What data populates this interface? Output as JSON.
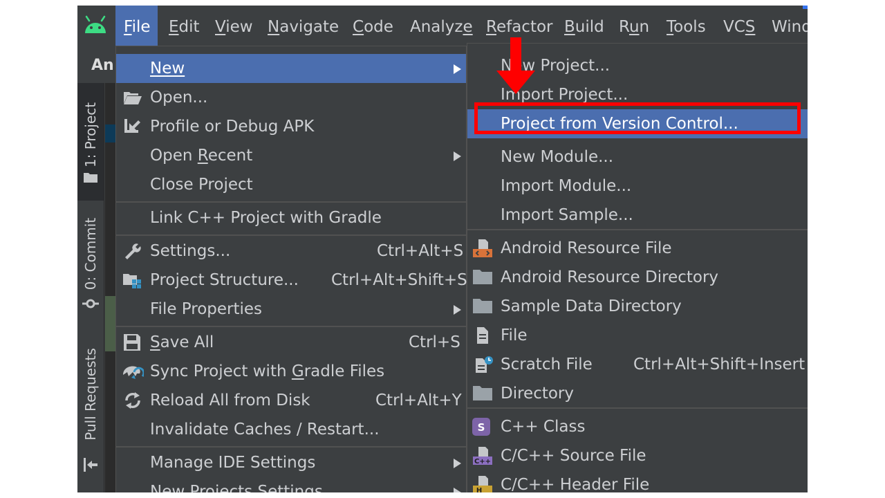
{
  "menubar": {
    "items": [
      {
        "label": "File",
        "mnemonic": 0,
        "active": true
      },
      {
        "label": "Edit",
        "mnemonic": 0
      },
      {
        "label": "View",
        "mnemonic": 0
      },
      {
        "label": "Navigate",
        "mnemonic": 0
      },
      {
        "label": "Code",
        "mnemonic": 0
      },
      {
        "label": "Analyze",
        "mnemonic": 6
      },
      {
        "label": "Refactor",
        "mnemonic": 0
      },
      {
        "label": "Build",
        "mnemonic": 0
      },
      {
        "label": "Run",
        "mnemonic": 1
      },
      {
        "label": "Tools",
        "mnemonic": 0
      },
      {
        "label": "VCS",
        "mnemonic": 2
      },
      {
        "label": "Wind",
        "mnemonic": -1
      }
    ]
  },
  "toolbar": {
    "project_label": "An"
  },
  "tool_stripe": {
    "project": "1: Project",
    "commit": "0: Commit",
    "pull_requests": "Pull Requests"
  },
  "file_menu": {
    "new": "New",
    "open": "Open...",
    "profile_debug_apk": "Profile or Debug APK",
    "open_recent": "Open Recent",
    "close_project": "Close Project",
    "link_cpp": "Link C++ Project with Gradle",
    "settings": "Settings...",
    "settings_shortcut": "Ctrl+Alt+S",
    "project_structure": "Project Structure...",
    "project_structure_shortcut": "Ctrl+Alt+Shift+S",
    "file_properties": "File Properties",
    "save_all": "Save All",
    "save_all_shortcut": "Ctrl+S",
    "sync_gradle": "Sync Project with Gradle Files",
    "reload_disk": "Reload All from Disk",
    "reload_disk_shortcut": "Ctrl+Alt+Y",
    "invalidate_caches": "Invalidate Caches / Restart...",
    "manage_ide": "Manage IDE Settings",
    "new_projects_settings": "New Projects Settings"
  },
  "new_submenu": {
    "new_project": "New Project...",
    "import_project": "Import Project...",
    "project_from_vcs": "Project from Version Control...",
    "new_module": "New Module...",
    "import_module": "Import Module...",
    "import_sample": "Import Sample...",
    "android_resource_file": "Android Resource File",
    "android_resource_directory": "Android Resource Directory",
    "sample_data_directory": "Sample Data Directory",
    "file": "File",
    "scratch_file": "Scratch File",
    "scratch_file_shortcut": "Ctrl+Alt+Shift+Insert",
    "directory": "Directory",
    "cpp_class": "C++ Class",
    "cpp_source_file": "C/C++ Source File",
    "cpp_header_file": "C/C++ Header File"
  },
  "colors": {
    "menu_bg": "#3c3f41",
    "selection": "#4b6eaf",
    "annotation_red": "#ff0000",
    "android_green": "#3ddc84"
  },
  "icons": {
    "android_logo": "android-logo-icon",
    "folder_open": "folder-open-icon",
    "profile_apk": "profile-apk-icon",
    "wrench": "wrench-icon",
    "project_structure": "project-structure-icon",
    "save": "save-icon",
    "sync_gradle": "sync-gradle-icon",
    "reload": "reload-icon",
    "resource_file": "android-resource-file-icon",
    "folder": "folder-icon",
    "file": "file-icon",
    "scratch": "scratch-file-icon",
    "cpp_class": "cpp-class-icon",
    "cpp_source": "cpp-source-icon",
    "cpp_header": "cpp-header-icon"
  }
}
